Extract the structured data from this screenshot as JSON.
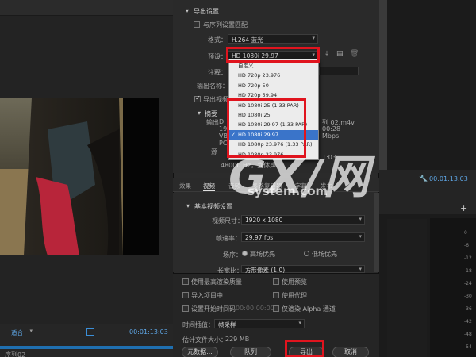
{
  "export_settings": {
    "section_title": "导出设置",
    "match_sequence_label": "与序列设置匹配",
    "format_label": "格式：",
    "format_value": "H.264 蓝光",
    "preset_label": "预设：",
    "preset_value": "HD 1080i 29.97",
    "comment_label": "注释：",
    "output_name_label": "输出名称：",
    "export_video_label": "导出视频",
    "summary_label": "摘要",
    "output_label": "输出",
    "source_label": "源",
    "fragments": {
      "a": "D:",
      "b": "列 02.m4v",
      "c": "19",
      "d": "00:28",
      "e": "VB",
      "f": "Mbps",
      "g": "PC",
      "h": "1:03",
      "i": "48000 Hz，立体声"
    }
  },
  "preset_options": [
    {
      "label": "自定义",
      "selected": false
    },
    {
      "label": "HD 720p 23.976",
      "selected": false
    },
    {
      "label": "HD 720p 50",
      "selected": false
    },
    {
      "label": "HD 720p 59.94",
      "selected": false
    },
    {
      "label": "HD 1080i 25 (1.33 PAR)",
      "selected": false
    },
    {
      "label": "HD 1080i 25",
      "selected": false
    },
    {
      "label": "HD 1080i 29.97 (1.33 PAR)",
      "selected": false
    },
    {
      "label": "HD 1080i 29.97",
      "selected": true
    },
    {
      "label": "HD 1080p 23.976 (1.33 PAR)",
      "selected": false
    },
    {
      "label": "HD 1080p 23.976",
      "selected": false
    }
  ],
  "tabs": [
    "效果",
    "视频",
    "音频",
    "多路复用器",
    "字幕",
    "发布"
  ],
  "basic_video": {
    "title": "基本视频设置",
    "frame_size_label": "视频尺寸：",
    "frame_size_value": "1920 x 1080",
    "frame_rate_label": "帧速率：",
    "frame_rate_value": "29.97 fps",
    "field_order_label": "场序：",
    "field_upper": "高场优先",
    "field_lower": "低场优先",
    "aspect_label": "长宽比：",
    "aspect_value": "方形像素 (1.0)"
  },
  "bottom_options": {
    "max_render_quality": "使用最高渲染质量",
    "use_previews": "使用预览",
    "import_into_project": "导入项目中",
    "use_proxies": "使用代理",
    "set_start_timecode": "设置开始时间码",
    "start_timecode": "00:00:00:00",
    "render_alpha_only": "仅渲染 Alpha 通道",
    "time_interpolation_label": "时间插值：",
    "time_interpolation_value": "帧采样",
    "estimated_size_label": "估计文件大小：",
    "estimated_size_value": "229 MB",
    "metadata_button": "元数据...",
    "queue_button": "队列",
    "export_button": "导出",
    "cancel_button": "取消"
  },
  "left_panel": {
    "fit_label": "适合",
    "timecode": "00:01:13:03",
    "bottom_text": "序列02"
  },
  "right_panel": {
    "timecode": "00:01:13:03",
    "ruler_labels": [
      "0",
      "-6",
      "-12",
      "-18",
      "-24",
      "-30",
      "-36",
      "-42",
      "-48",
      "-54"
    ]
  },
  "watermark": {
    "logo": "GX/网",
    "site": "system.com"
  },
  "colors": {
    "highlight": "#e0141e",
    "selection": "#3a74c9"
  }
}
